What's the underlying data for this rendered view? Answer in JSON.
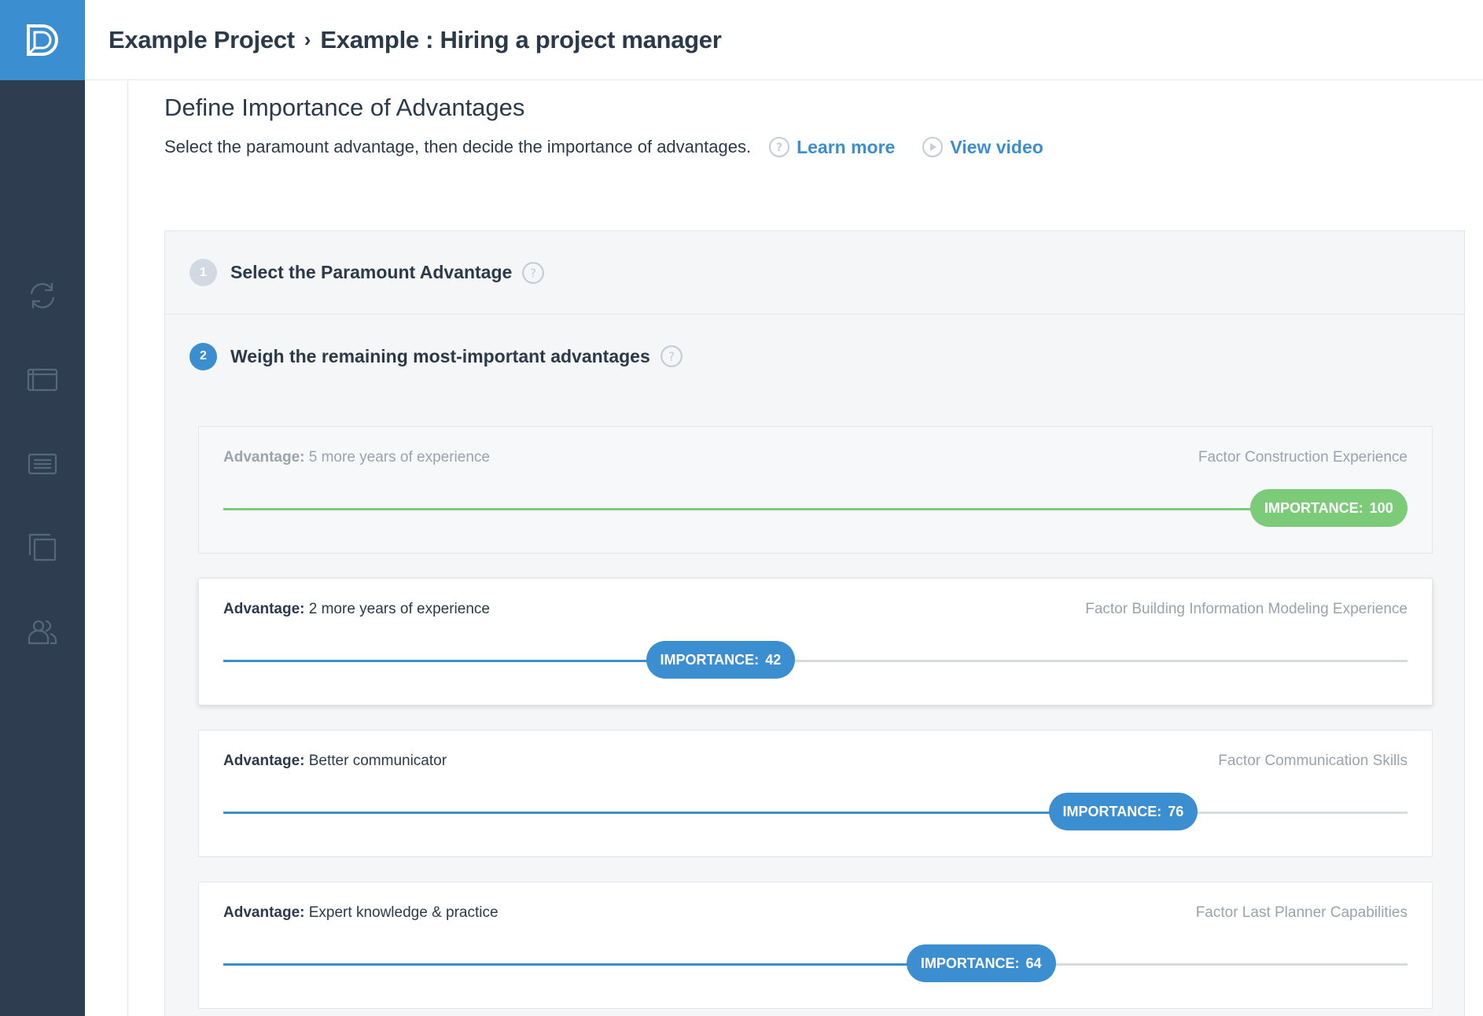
{
  "header": {
    "project": "Example Project",
    "separator": "›",
    "decision": "Example : Hiring a project manager"
  },
  "sidebar": {
    "icons": [
      "logo-icon",
      "sync-icon",
      "folder-icon",
      "list-icon",
      "copy-icon",
      "users-icon"
    ]
  },
  "page": {
    "title": "Define Importance of Advantages",
    "subtitle": "Select the paramount advantage, then decide the importance of advantages.",
    "learn_more": "Learn more",
    "view_video": "View video"
  },
  "steps": [
    {
      "number": "1",
      "label": "Select the Paramount Advantage"
    },
    {
      "number": "2",
      "label": "Weigh the remaining most-important advantages"
    }
  ],
  "advantage_prefix": "Advantage:",
  "importance_label": "IMPORTANCE:",
  "colors": {
    "accent": "#3b8ed0",
    "paramount": "#7ccb78",
    "sidebar": "#2e3e50"
  },
  "advantages": [
    {
      "advantage": "5 more years of experience",
      "factor": "Factor Construction Experience",
      "importance": "100",
      "fraction": 1.0,
      "paramount": true
    },
    {
      "advantage": "2 more years of experience",
      "factor": "Factor Building Information Modeling Experience",
      "importance": "42",
      "fraction": 0.42,
      "paramount": false
    },
    {
      "advantage": "Better communicator",
      "factor": "Factor Communication Skills",
      "importance": "76",
      "fraction": 0.76,
      "paramount": false
    },
    {
      "advantage": "Expert knowledge & practice",
      "factor": "Factor Last Planner Capabilities",
      "importance": "64",
      "fraction": 0.64,
      "paramount": false
    }
  ]
}
